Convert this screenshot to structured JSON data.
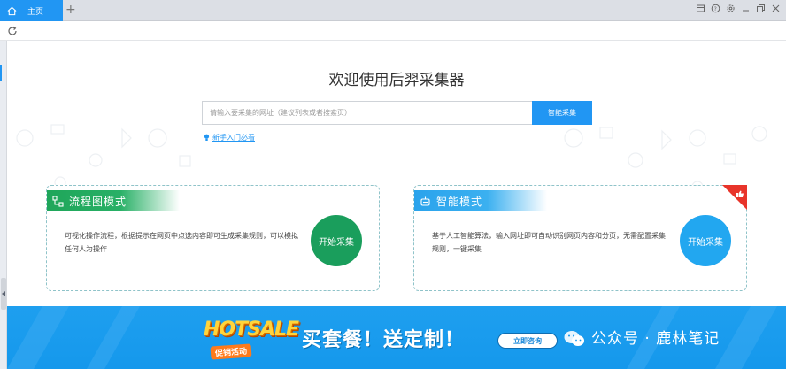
{
  "tabbar": {
    "tab_label": "主页",
    "add_symbol": "+",
    "icons": [
      "skin-icon",
      "help-icon",
      "settings-icon",
      "minimize-icon",
      "restore-icon",
      "close-icon"
    ]
  },
  "main": {
    "welcome_title": "欢迎使用后羿采集器",
    "search": {
      "placeholder": "请输入要采集的网址（建议列表或者搜索页）",
      "button_label": "智能采集"
    },
    "guide_link": "新手入门必看"
  },
  "cards": {
    "flow": {
      "title": "流程图模式",
      "description": "可视化操作流程，根据提示在网页中点选内容即可生成采集规则，可以模拟任何人为操作",
      "button_label": "开始采集",
      "color": "#1a9e5c"
    },
    "smart": {
      "title": "智能模式",
      "description": "基于人工智能算法，输入网址即可自动识别网页内容和分页，无需配置采集规则，一键采集",
      "button_label": "开始采集",
      "color": "#22a7f0"
    }
  },
  "banner": {
    "hotsale": "HOTSALE",
    "hotsale_sub": "促销活动",
    "headline": "买套餐！送定制！",
    "consult_label": "立即咨询",
    "watermark": "公众号 · 鹿林笔记"
  },
  "colors": {
    "accent": "#2196f3",
    "tab_bg": "#dcdfe5"
  }
}
